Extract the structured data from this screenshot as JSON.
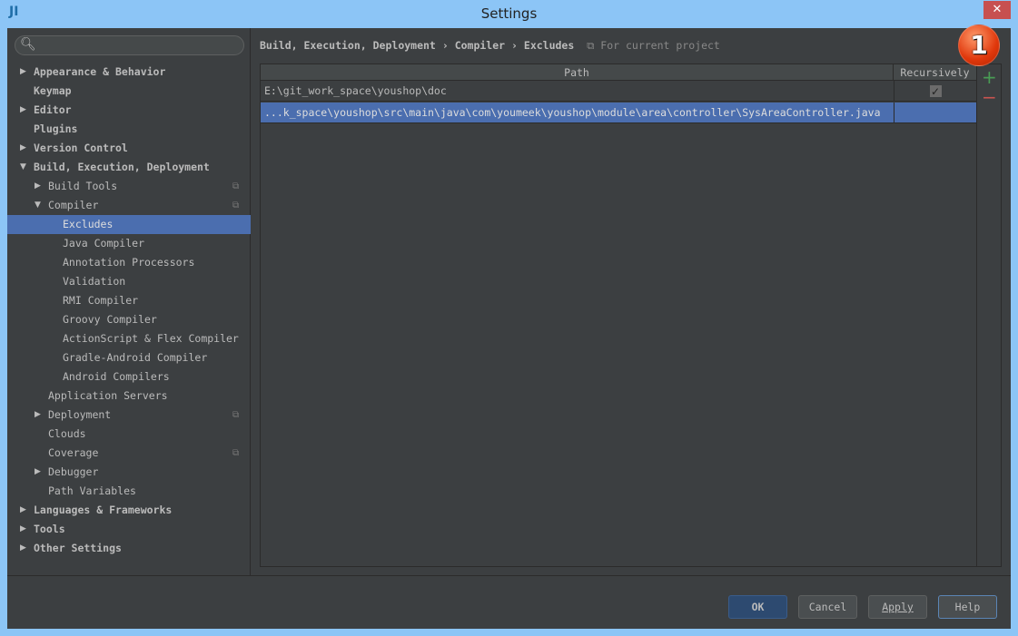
{
  "window": {
    "title": "Settings",
    "logo": "JI",
    "close": "✕"
  },
  "search": {
    "placeholder": "",
    "icon": "search-icon"
  },
  "tree": [
    {
      "label": "Appearance & Behavior",
      "level": 0,
      "arrow": "right",
      "bold": true
    },
    {
      "label": "Keymap",
      "level": 0,
      "bold": true
    },
    {
      "label": "Editor",
      "level": 0,
      "arrow": "right",
      "bold": true
    },
    {
      "label": "Plugins",
      "level": 0,
      "bold": true
    },
    {
      "label": "Version Control",
      "level": 0,
      "arrow": "right",
      "bold": true
    },
    {
      "label": "Build, Execution, Deployment",
      "level": 0,
      "arrow": "down",
      "bold": true
    },
    {
      "label": "Build Tools",
      "level": 1,
      "arrow": "right",
      "copy": true
    },
    {
      "label": "Compiler",
      "level": 1,
      "arrow": "down",
      "copy": true
    },
    {
      "label": "Excludes",
      "level": 2,
      "selected": true
    },
    {
      "label": "Java Compiler",
      "level": 2
    },
    {
      "label": "Annotation Processors",
      "level": 2
    },
    {
      "label": "Validation",
      "level": 2
    },
    {
      "label": "RMI Compiler",
      "level": 2
    },
    {
      "label": "Groovy Compiler",
      "level": 2
    },
    {
      "label": "ActionScript & Flex Compiler",
      "level": 2
    },
    {
      "label": "Gradle-Android Compiler",
      "level": 2
    },
    {
      "label": "Android Compilers",
      "level": 2
    },
    {
      "label": "Application Servers",
      "level": 1
    },
    {
      "label": "Deployment",
      "level": 1,
      "arrow": "right",
      "copy": true
    },
    {
      "label": "Clouds",
      "level": 1
    },
    {
      "label": "Coverage",
      "level": 1,
      "copy": true
    },
    {
      "label": "Debugger",
      "level": 1,
      "arrow": "right"
    },
    {
      "label": "Path Variables",
      "level": 1
    },
    {
      "label": "Languages & Frameworks",
      "level": 0,
      "arrow": "right",
      "bold": true
    },
    {
      "label": "Tools",
      "level": 0,
      "arrow": "right",
      "bold": true
    },
    {
      "label": "Other Settings",
      "level": 0,
      "arrow": "right",
      "bold": true
    }
  ],
  "breadcrumb": {
    "items": [
      "Build, Execution, Deployment",
      "Compiler",
      "Excludes"
    ],
    "separator": "›",
    "project_label": "For current project"
  },
  "table": {
    "columns": [
      "Path",
      "Recursively"
    ],
    "rows": [
      {
        "path": "E:\\git_work_space\\youshop\\doc",
        "recursive": true
      },
      {
        "path": "...k_space\\youshop\\src\\main\\java\\com\\youmeek\\youshop\\module\\area\\controller\\SysAreaController.java",
        "recursive": false,
        "selected": true
      }
    ]
  },
  "toolbar": {
    "add": "+",
    "remove": "−",
    "add_color": "#499c54",
    "remove_color": "#c75450"
  },
  "badge": "1",
  "buttons": {
    "ok": "OK",
    "cancel": "Cancel",
    "apply": "Apply",
    "help": "Help"
  }
}
